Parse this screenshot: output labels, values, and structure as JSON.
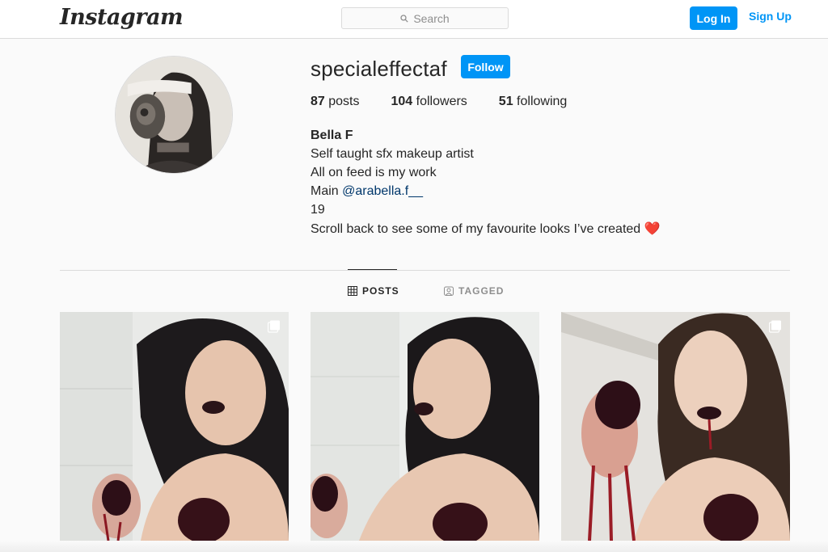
{
  "header": {
    "logo_text": "Instagram",
    "search_placeholder": "Search",
    "login_label": "Log In",
    "signup_label": "Sign Up"
  },
  "profile": {
    "username": "specialeffectaf",
    "follow_label": "Follow",
    "stats": {
      "posts_count": "87",
      "posts_label": "posts",
      "followers_count": "104",
      "followers_label": "followers",
      "following_count": "51",
      "following_label": "following"
    },
    "bio": {
      "name": "Bella F",
      "line1": "Self taught sfx makeup artist",
      "line2": "All on feed is my work",
      "line3_prefix": "Main ",
      "line3_mention": "@arabella.f__",
      "line4": "19",
      "line5": "Scroll back to see some of my favourite looks I’ve created",
      "line5_emoji": "❤️"
    }
  },
  "tabs": [
    {
      "label": "POSTS",
      "icon": "grid-icon",
      "active": true
    },
    {
      "label": "TAGGED",
      "icon": "tag-user-icon",
      "active": false
    }
  ],
  "posts": [
    {
      "icon": "multiple-photos-icon"
    },
    {
      "icon": "none"
    },
    {
      "icon": "multiple-photos-icon"
    }
  ],
  "colors": {
    "accent": "#0095f6",
    "link": "#00376b",
    "border": "#dbdbdb",
    "background": "#fafafa"
  }
}
